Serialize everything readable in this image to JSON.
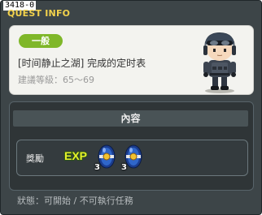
{
  "window": {
    "id_label": "3418-0",
    "title": "QUEST INFO"
  },
  "quest": {
    "category_badge": "一般",
    "name": "[时间静止之湖] 完成的定时表",
    "level_text": "建議等級：65～69",
    "npc_icon": "soldier-npc-portrait"
  },
  "content": {
    "header": "內容",
    "reward_label": "獎勵",
    "rewards": [
      {
        "icon": "exp-icon",
        "text": "EXP"
      },
      {
        "icon": "blue-orb-item-icon",
        "count": "3"
      },
      {
        "icon": "blue-orb-item-icon",
        "count": "3"
      }
    ]
  },
  "status": {
    "text": "狀態：可開始 / 不可執行任務"
  },
  "colors": {
    "title": "#f3d24c",
    "badge": "#7fb729",
    "window_bg": "#3d4548",
    "top_panel_bg": "#f3f3ef"
  }
}
